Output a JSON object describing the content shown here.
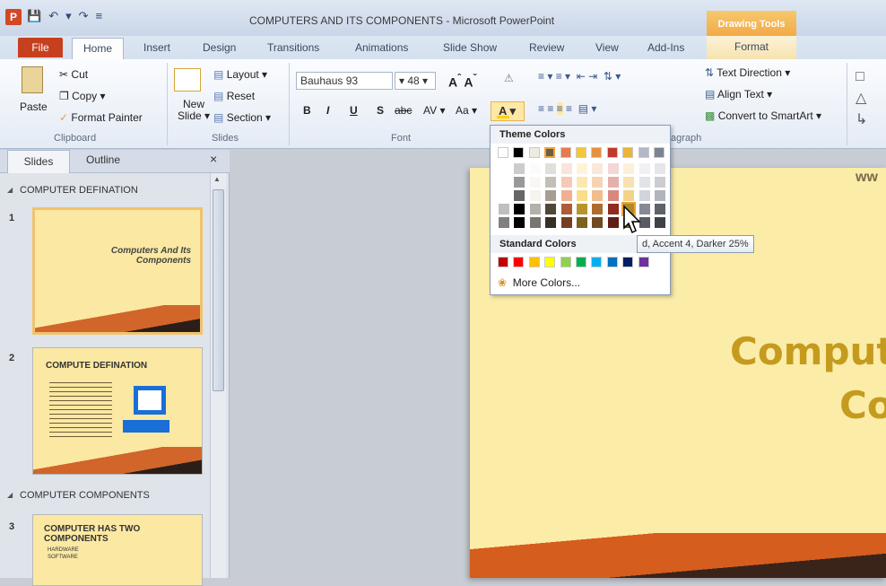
{
  "titlebar": {
    "title": "COMPUTERS AND ITS COMPONENTS - Microsoft PowerPoint",
    "context_tab": "Drawing Tools",
    "logo": "P"
  },
  "tabs": [
    "File",
    "Home",
    "Insert",
    "Design",
    "Transitions",
    "Animations",
    "Slide Show",
    "Review",
    "View",
    "Add-Ins",
    "Format"
  ],
  "ribbon": {
    "clipboard": {
      "paste": "Paste",
      "cut": "Cut",
      "copy": "Copy",
      "format_painter": "Format Painter",
      "label": "Clipboard"
    },
    "slides": {
      "new_slide_1": "New",
      "new_slide_2": "Slide",
      "layout": "Layout",
      "reset": "Reset",
      "section": "Section",
      "label": "Slides"
    },
    "font": {
      "name": "Bauhaus 93",
      "size": "48",
      "label": "Font",
      "bold": "B",
      "italic": "I",
      "underline": "U",
      "shadow": "S",
      "strike": "abc",
      "spacing": "AV",
      "case": "Aa",
      "color": "A"
    },
    "paragraph": {
      "label": "Paragraph",
      "label_visible": "agraph",
      "text_direction": "Text Direction",
      "align_text": "Align Text",
      "smartart": "Convert to SmartArt"
    }
  },
  "panel": {
    "tabs": [
      "Slides",
      "Outline"
    ],
    "close": "×",
    "sections": [
      "COMPUTER DEFINATION",
      "COMPUTER COMPONENTS"
    ],
    "slides": [
      {
        "num": "1",
        "title": "Computers And Its Components"
      },
      {
        "num": "2",
        "title": "COMPUTE DEFINATION"
      },
      {
        "num": "3",
        "title": "COMPUTER HAS TWO COMPONENTS",
        "items": [
          "HARDWARE",
          "SOFTWARE"
        ]
      }
    ]
  },
  "slide": {
    "title_line1": "Comput",
    "title_line2": "Co",
    "www": "ww"
  },
  "dropdown": {
    "theme_label": "Theme Colors",
    "standard_label": "Standard Colors",
    "more": "More Colors...",
    "tooltip": "d, Accent 4, Darker 25%",
    "theme_colors": [
      "#ffffff",
      "#000000",
      "#eeece1",
      "#6b5e48",
      "#e8794a",
      "#f5c63a",
      "#e69140",
      "#c0392b",
      "#eab53a",
      "#b3b8c7",
      "#7c828f"
    ],
    "standard_colors": [
      "#c00000",
      "#ff0000",
      "#ffc000",
      "#ffff00",
      "#92d050",
      "#00b050",
      "#00b0f0",
      "#0070c0",
      "#002060",
      "#7030a0"
    ]
  }
}
